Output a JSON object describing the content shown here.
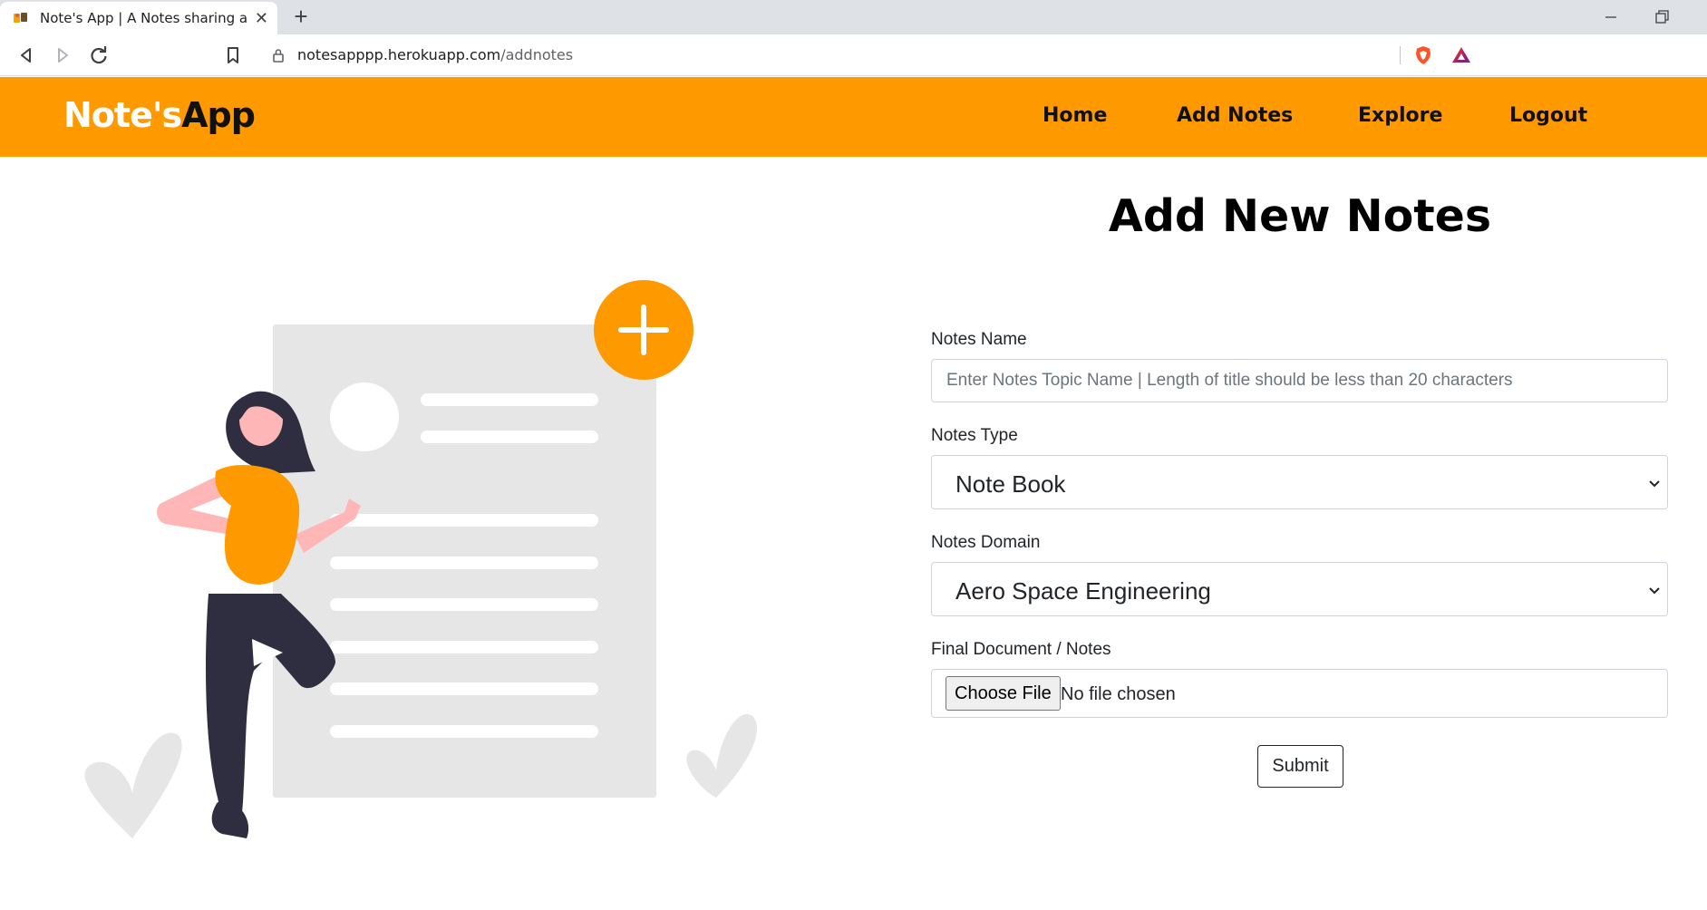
{
  "browser": {
    "tab_title": "Note's App | A Notes sharing app",
    "tab_close": "✕",
    "new_tab": "+",
    "url_domain": "notesapppp.herokuapp.com",
    "url_path": "/addnotes"
  },
  "navbar": {
    "brand_part1": "Note's",
    "brand_part2": "App",
    "links": [
      "Home",
      "Add Notes",
      "Explore",
      "Logout"
    ]
  },
  "page": {
    "title": "Add New Notes"
  },
  "form": {
    "name_label": "Notes Name",
    "name_placeholder": "Enter Notes Topic Name | Length of title should be less than 20 characters",
    "type_label": "Notes Type",
    "type_value": "Note Book",
    "domain_label": "Notes Domain",
    "domain_value": "Aero Space Engineering",
    "file_label": "Final Document / Notes",
    "file_button": "Choose File",
    "file_status": "No file chosen",
    "submit_label": "Submit"
  },
  "colors": {
    "accent": "#ff9900",
    "illustration_gray": "#e6e6e6",
    "figure_dark": "#2f2e41",
    "skin": "#ffb6b6"
  },
  "icons": {
    "favicon": "app-favicon-icon",
    "back": "back-arrow-icon",
    "forward": "forward-arrow-icon",
    "reload": "reload-icon",
    "bookmark": "bookmark-icon",
    "lock": "lock-icon",
    "brave": "brave-shield-icon",
    "rewards": "brave-rewards-icon",
    "add": "plus-circle-icon"
  }
}
